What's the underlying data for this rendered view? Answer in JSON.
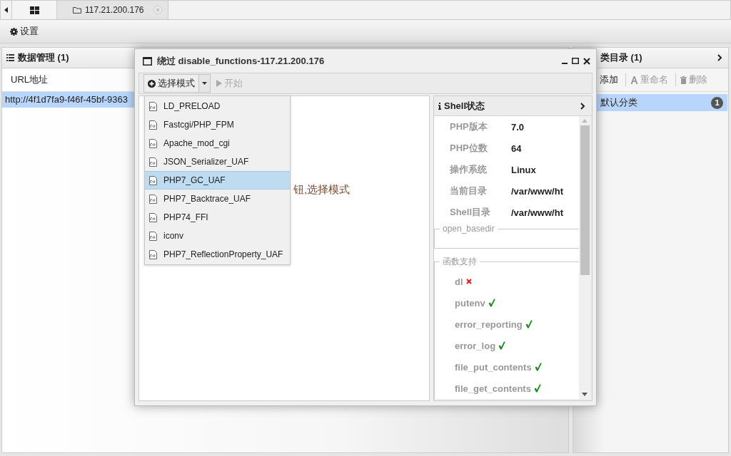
{
  "tabs": [
    {
      "kind": "home",
      "selected": true
    },
    {
      "kind": "folder",
      "label": "117.21.200.176",
      "selected": false
    }
  ],
  "toolbar": {
    "settings": "设置"
  },
  "data_panel": {
    "title": "数据管理 (1)",
    "column": "URL地址",
    "rows": [
      {
        "url": "http://4f1d7fa9-f46f-45bf-9363",
        "selected": true
      }
    ]
  },
  "category_panel": {
    "title": "类目录 (1)",
    "buttons": [
      {
        "kind": "add",
        "label": "添加",
        "disabled": false
      },
      {
        "kind": "rename",
        "label": "重命名",
        "disabled": true
      },
      {
        "kind": "delete",
        "label": "删除",
        "disabled": true
      }
    ],
    "items": [
      {
        "label": "默认分类",
        "count": "1",
        "selected": true
      }
    ]
  },
  "dialog": {
    "title": "绕过 disable_functions-117.21.200.176",
    "mode_button": "选择模式",
    "start_button": {
      "label": "开始",
      "disabled": true
    },
    "hint": "钮,选择模式",
    "modes": [
      {
        "label": "LD_PRELOAD",
        "selected": false
      },
      {
        "label": "Fastcgi/PHP_FPM",
        "selected": false
      },
      {
        "label": "Apache_mod_cgi",
        "selected": false
      },
      {
        "label": "JSON_Serializer_UAF",
        "selected": false
      },
      {
        "label": "PHP7_GC_UAF",
        "selected": true
      },
      {
        "label": "PHP7_Backtrace_UAF",
        "selected": false
      },
      {
        "label": "PHP74_FFI",
        "selected": false
      },
      {
        "label": "iconv",
        "selected": false
      },
      {
        "label": "PHP7_ReflectionProperty_UAF",
        "selected": false
      }
    ],
    "shell_status": {
      "title": "Shell状态",
      "info": [
        {
          "label": "PHP版本",
          "value": "7.0"
        },
        {
          "label": "PHP位数",
          "value": "64"
        },
        {
          "label": "操作系统",
          "value": "Linux"
        },
        {
          "label": "当前目录",
          "value": "/var/www/ht"
        },
        {
          "label": "Shell目录",
          "value": "/var/www/ht"
        }
      ],
      "open_basedir": "open_basedir",
      "functions_legend": "函数支持",
      "functions": [
        {
          "name": "dl",
          "supported": false
        },
        {
          "name": "putenv",
          "supported": true
        },
        {
          "name": "error_reporting",
          "supported": true
        },
        {
          "name": "error_log",
          "supported": true
        },
        {
          "name": "file_put_contents",
          "supported": true
        },
        {
          "name": "file_get_contents",
          "supported": true
        }
      ]
    }
  }
}
